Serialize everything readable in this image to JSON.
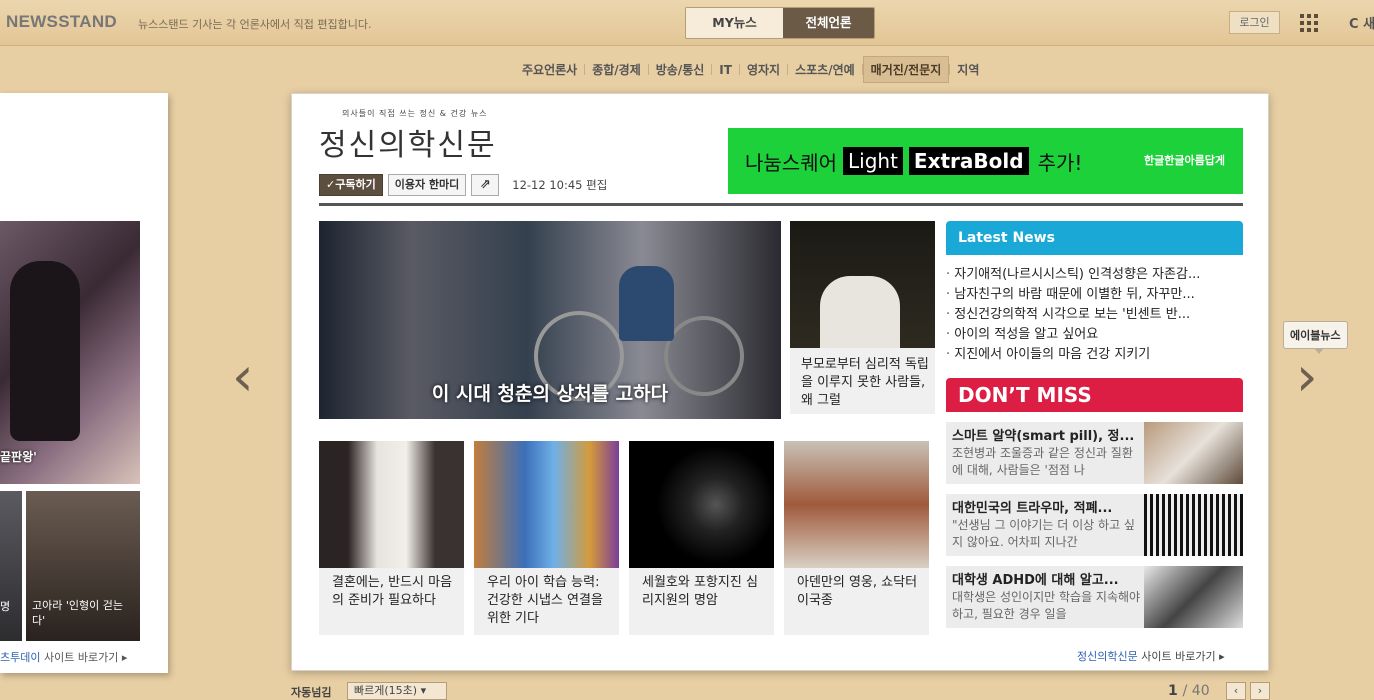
{
  "topbar": {
    "logo": "NEWSSTAND",
    "tagline": "뉴스스탠드 기사는 각 언론사에서 직접 편집합니다.",
    "tab_my": "MY뉴스",
    "tab_all": "전체언론사",
    "login": "로그인",
    "refresh": "C 새"
  },
  "categories": [
    "주요언론사",
    "종합/경제",
    "방송/통신",
    "IT",
    "영자지",
    "스포츠/연예",
    "매거진/전문지",
    "지역"
  ],
  "categories_active": "매거진/전문지",
  "left_panel": {
    "caption1": "끝판왕'",
    "caption2": "명",
    "caption3": "고아라 '인형이 걷는 다'",
    "footer_site": "츠투데이",
    "footer_link": "사이트 바로가기"
  },
  "tooltip": "에이블뉴스",
  "press": {
    "small_title": "의사들이 직접 쓰는 정신 & 건강 뉴스",
    "name": "정신의학신문",
    "subscribe": "✓구독하기",
    "comment": "이용자 한마디",
    "edit_time": "12-12 10:45 편집"
  },
  "banner": {
    "text1": "나눔스퀘어",
    "badge1": "Light",
    "badge2": "ExtraBold",
    "text2": "추가!",
    "brand": "한글한글아름답게"
  },
  "hero": {
    "caption": "이 시대 청춘의 상처를 고하다"
  },
  "side_story": {
    "caption": "부모로부터 심리적 독립을 이루지 못한 사람들, 왜 그럴"
  },
  "thumbs": [
    {
      "caption": "결혼에는, 반드시 마음의 준비가 필요하다"
    },
    {
      "caption": "우리 아이 학습 능력: 건강한 시냅스 연결을 위한 기다"
    },
    {
      "caption": "세월호와 포항지진 심리지원의 명암"
    },
    {
      "caption": "아덴만의 영웅, 쇼닥터 이국종"
    }
  ],
  "latest": {
    "header": "Latest News",
    "items": [
      "자기애적(나르시시스틱) 인격성향은 자존감...",
      "남자친구의 바람 때문에 이별한 뒤, 자꾸만...",
      "정신건강의학적 시각으로 보는 '빈센트 반...",
      "아이의 적성을 알고 싶어요",
      "지진에서 아이들의 마음 건강 지키기"
    ]
  },
  "dont_miss": {
    "header": "DON’T MISS",
    "items": [
      {
        "title": "스마트 알약(smart pill), 정...",
        "summary": "조현병과 조울증과 같은 정신과 질환에 대해, 사람들은 '점점 나"
      },
      {
        "title": "대한민국의 트라우마, 적폐...",
        "summary": "\"선생님 그 이야기는 더 이상 하고 싶지 않아요. 어차피 지나간"
      },
      {
        "title": "대학생 ADHD에 대해 알고...",
        "summary": "대학생은 성인이지만 학습을 지속해야 하고, 필요한 경우 일을"
      }
    ]
  },
  "main_footer": {
    "site": "정신의학신문",
    "link": "사이트 바로가기"
  },
  "bottom": {
    "auto_label": "자동넘김",
    "speed": "빠르게(15초)",
    "page_current": "1",
    "page_total": "/ 40"
  },
  "colors": {
    "latest": "#1aa8d7",
    "dont_miss": "#dc1d44",
    "banner": "#1dd13b"
  }
}
